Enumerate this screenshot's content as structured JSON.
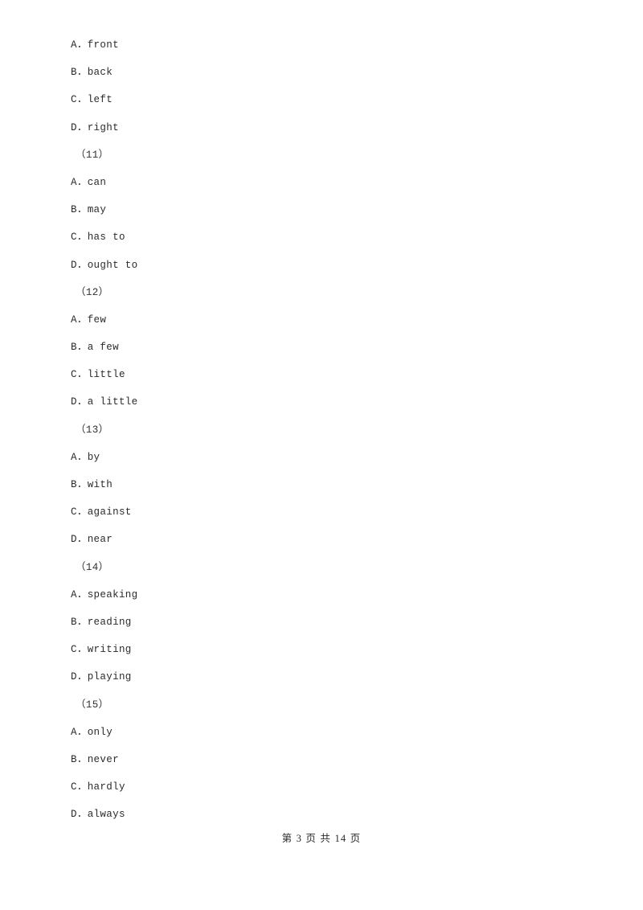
{
  "document": {
    "page_background": "#ffffff",
    "text_color": "#2b2b2b",
    "lines": [
      {
        "kind": "option",
        "text": "A．front"
      },
      {
        "kind": "option",
        "text": "B．back"
      },
      {
        "kind": "option",
        "text": "C．left"
      },
      {
        "kind": "option",
        "text": "D．right"
      },
      {
        "kind": "blank-marker",
        "text": "（11）"
      },
      {
        "kind": "option",
        "text": "A．can"
      },
      {
        "kind": "option",
        "text": "B．may"
      },
      {
        "kind": "option",
        "text": "C．has to"
      },
      {
        "kind": "option",
        "text": "D．ought to"
      },
      {
        "kind": "blank-marker",
        "text": "（12）"
      },
      {
        "kind": "option",
        "text": "A．few"
      },
      {
        "kind": "option",
        "text": "B．a few"
      },
      {
        "kind": "option",
        "text": "C．little"
      },
      {
        "kind": "option",
        "text": "D．a little"
      },
      {
        "kind": "blank-marker",
        "text": "（13）"
      },
      {
        "kind": "option",
        "text": "A．by"
      },
      {
        "kind": "option",
        "text": "B．with"
      },
      {
        "kind": "option",
        "text": "C．against"
      },
      {
        "kind": "option",
        "text": "D．near"
      },
      {
        "kind": "blank-marker",
        "text": "（14）"
      },
      {
        "kind": "option",
        "text": "A．speaking"
      },
      {
        "kind": "option",
        "text": "B．reading"
      },
      {
        "kind": "option",
        "text": "C．writing"
      },
      {
        "kind": "option",
        "text": "D．playing"
      },
      {
        "kind": "blank-marker",
        "text": "（15）"
      },
      {
        "kind": "option",
        "text": "A．only"
      },
      {
        "kind": "option",
        "text": "B．never"
      },
      {
        "kind": "option",
        "text": "C．hardly"
      },
      {
        "kind": "option",
        "text": "D．always"
      }
    ]
  },
  "footer": {
    "page_label": "第 3 页 共 14 页",
    "current_page": 3,
    "total_pages": 14
  }
}
